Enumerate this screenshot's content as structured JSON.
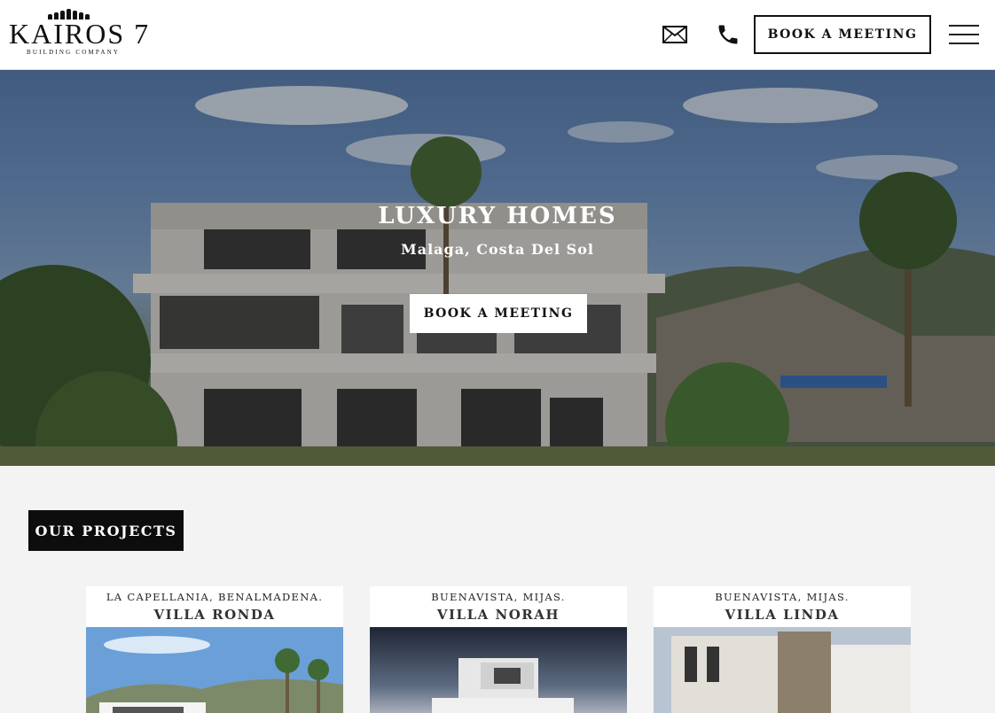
{
  "brand": {
    "name": "KAIROS 7",
    "tagline": "BUILDING COMPANY"
  },
  "header": {
    "mail_icon": "envelope-icon",
    "phone_icon": "phone-icon",
    "book_label": "BOOK A MEETING",
    "menu_icon": "hamburger-menu-icon"
  },
  "hero": {
    "title": "LUXURY HOMES",
    "subtitle": "Malaga, Costa Del Sol",
    "book_label": "BOOK A MEETING"
  },
  "projects": {
    "heading": "OUR PROJECTS",
    "items": [
      {
        "location": "LA CAPELLANIA, BENALMADENA.",
        "name": "VILLA RONDA"
      },
      {
        "location": "BUENAVISTA, MIJAS.",
        "name": "VILLA NORAH"
      },
      {
        "location": "BUENAVISTA, MIJAS.",
        "name": "VILLA LINDA"
      }
    ]
  },
  "colors": {
    "dark": "#0d0d0d",
    "background": "#f3f3f3",
    "white": "#ffffff"
  }
}
